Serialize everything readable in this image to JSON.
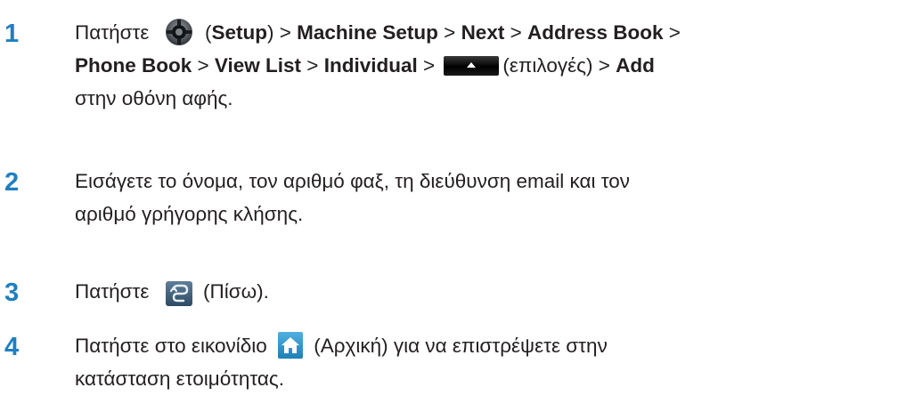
{
  "steps": [
    {
      "number": "1",
      "line1": {
        "t1": "Πατήστε ",
        "icon1": "setup-gear-icon",
        "t2": " (",
        "b1": "Setup",
        "t3": ") > ",
        "b2": "Machine Setup",
        "t4": " > ",
        "b3": "Next",
        "t5": " > ",
        "b4": "Address Book",
        "t6": " >"
      },
      "line2": {
        "b1": "Phone Book",
        "t1": " > ",
        "b2": "View List",
        "t2": " > ",
        "b3": "Individual",
        "t3": " > ",
        "icon1": "options-button-icon",
        "t4": "(επιλογές) > ",
        "b4": "Add"
      },
      "line3": "στην οθόνη αφής."
    },
    {
      "number": "2",
      "line1": "Εισάγετε το όνομα, τον αριθμό φαξ, τη διεύθυνση email και τον",
      "line2": "αριθμό γρήγορης κλήσης."
    },
    {
      "number": "3",
      "t1": "Πατήστε ",
      "icon1": "back-icon",
      "t2": " (Πίσω)."
    },
    {
      "number": "4",
      "t1": "Πατήστε στο εικονίδιο ",
      "icon1": "home-icon",
      "t2": " (Αρχική) για να επιστρέψετε στην",
      "line2": "κατάσταση ετοιμότητας."
    }
  ],
  "colors": {
    "step_number": "#1e7fc1",
    "text": "#231f20"
  }
}
